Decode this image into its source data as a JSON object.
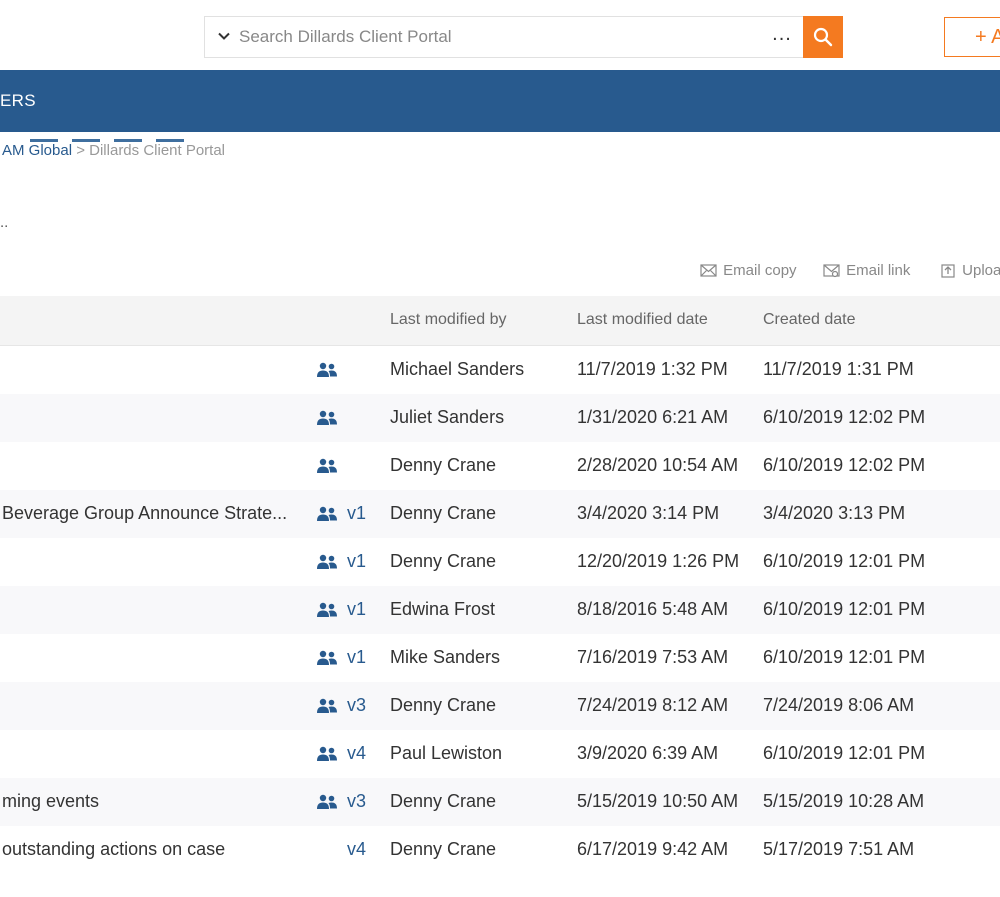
{
  "search": {
    "placeholder": "Search Dillards Client Portal",
    "more_label": "...",
    "add_label": "+ A"
  },
  "header": {
    "title": "ERS"
  },
  "breadcrumb": {
    "parent": "AM Global",
    "separator": ">",
    "current": "Dillards Client Portal"
  },
  "description_fragment": "..",
  "actions": {
    "email_copy": "Email copy",
    "email_link": "Email link",
    "upload": "Uploa"
  },
  "table": {
    "columns": {
      "last_modified_by": "Last modified by",
      "last_modified_date": "Last modified date",
      "created_date": "Created date"
    },
    "rows": [
      {
        "name": "",
        "shared": true,
        "version": "",
        "modified_by": "Michael Sanders",
        "modified": "11/7/2019 1:32 PM",
        "created": "11/7/2019 1:31 PM"
      },
      {
        "name": "",
        "shared": true,
        "version": "",
        "modified_by": "Juliet Sanders",
        "modified": "1/31/2020 6:21 AM",
        "created": "6/10/2019 12:02 PM"
      },
      {
        "name": "",
        "shared": true,
        "version": "",
        "modified_by": "Denny Crane",
        "modified": "2/28/2020 10:54 AM",
        "created": "6/10/2019 12:02 PM"
      },
      {
        "name": "Beverage Group Announce Strate...",
        "shared": true,
        "version": "v1",
        "modified_by": "Denny Crane",
        "modified": "3/4/2020 3:14 PM",
        "created": "3/4/2020 3:13 PM"
      },
      {
        "name": "",
        "shared": true,
        "version": "v1",
        "modified_by": "Denny Crane",
        "modified": "12/20/2019 1:26 PM",
        "created": "6/10/2019 12:01 PM"
      },
      {
        "name": "",
        "shared": true,
        "version": "v1",
        "modified_by": "Edwina Frost",
        "modified": "8/18/2016 5:48 AM",
        "created": "6/10/2019 12:01 PM"
      },
      {
        "name": "",
        "shared": true,
        "version": "v1",
        "modified_by": "Mike Sanders",
        "modified": "7/16/2019 7:53 AM",
        "created": "6/10/2019 12:01 PM"
      },
      {
        "name": "",
        "shared": true,
        "version": "v3",
        "modified_by": "Denny Crane",
        "modified": "7/24/2019 8:12 AM",
        "created": "7/24/2019 8:06 AM"
      },
      {
        "name": "",
        "shared": true,
        "version": "v4",
        "modified_by": "Paul Lewiston",
        "modified": "3/9/2020 6:39 AM",
        "created": "6/10/2019 12:01 PM"
      },
      {
        "name": "ming events",
        "shared": true,
        "version": "v3",
        "modified_by": "Denny Crane",
        "modified": "5/15/2019 10:50 AM",
        "created": "5/15/2019 10:28 AM"
      },
      {
        "name": "outstanding actions on case",
        "shared": false,
        "version": "v4",
        "modified_by": "Denny Crane",
        "modified": "6/17/2019 9:42 AM",
        "created": "5/17/2019 7:51 AM"
      }
    ]
  },
  "colors": {
    "brand_blue": "#285a8e",
    "accent_orange": "#f47a20"
  },
  "icons": {
    "search": "search-icon",
    "chevron": "chevron-down-icon",
    "share": "shared-users-icon",
    "email_copy": "email-copy-icon",
    "email_link": "email-link-icon",
    "upload": "upload-icon"
  }
}
